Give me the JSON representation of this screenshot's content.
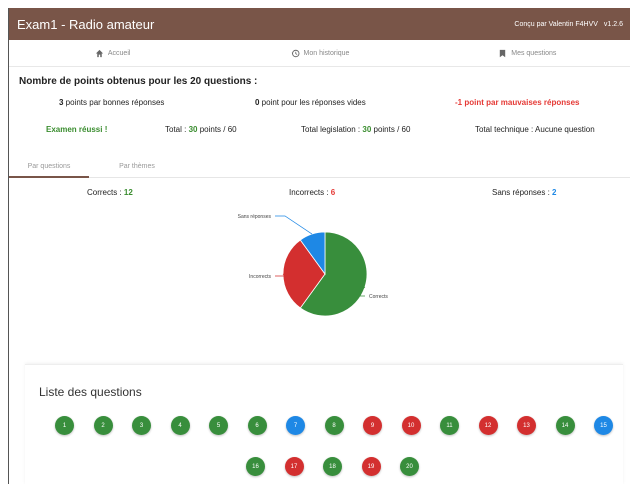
{
  "appbar": {
    "title": "Exam1 - Radio amateur",
    "credit": "Conçu par Valentin F4HVV",
    "version": "v1.2.6"
  },
  "nav": [
    {
      "label": "Accueil",
      "icon": "home-icon"
    },
    {
      "label": "Mon historique",
      "icon": "history-icon"
    },
    {
      "label": "Mes questions",
      "icon": "bookmark-icon"
    }
  ],
  "summary": {
    "title": "Nombre de points obtenus pour les 20 questions :",
    "good_num": "3",
    "good_text": " points par bonnes réponses",
    "empty_num": "0",
    "empty_text": " point pour les réponses vides",
    "bad_text": "-1 point par mauvaises réponses",
    "result": "Examen réussi !",
    "total_label": "Total : ",
    "total_value": "30",
    "total_suffix": " points / 60",
    "legis_label": "Total legislation : ",
    "legis_value": "30",
    "legis_suffix": " points / 60",
    "tech_text": "Total technique : Aucune question"
  },
  "tabs": [
    {
      "label": "Par questions",
      "active": true
    },
    {
      "label": "Par thèmes",
      "active": false
    }
  ],
  "counts": {
    "correct_label": "Corrects : ",
    "correct_value": "12",
    "incorrect_label": "Incorrects : ",
    "incorrect_value": "6",
    "empty_label": "Sans réponses : ",
    "empty_value": "2"
  },
  "chart_data": {
    "type": "pie",
    "slices": [
      {
        "label": "Corrects",
        "value": 12,
        "color": "#388e3c"
      },
      {
        "label": "Incorrects",
        "value": 6,
        "color": "#d32f2f"
      },
      {
        "label": "Sans réponses",
        "value": 2,
        "color": "#1e88e5"
      }
    ]
  },
  "questions": {
    "title": "Liste des questions",
    "colors": {
      "correct": "#388e3c",
      "incorrect": "#d32f2f",
      "empty": "#1e88e5"
    },
    "items": [
      {
        "n": "1",
        "status": "correct"
      },
      {
        "n": "2",
        "status": "correct"
      },
      {
        "n": "3",
        "status": "correct"
      },
      {
        "n": "4",
        "status": "correct"
      },
      {
        "n": "5",
        "status": "correct"
      },
      {
        "n": "6",
        "status": "correct"
      },
      {
        "n": "7",
        "status": "empty"
      },
      {
        "n": "8",
        "status": "correct"
      },
      {
        "n": "9",
        "status": "incorrect"
      },
      {
        "n": "10",
        "status": "incorrect"
      },
      {
        "n": "11",
        "status": "correct"
      },
      {
        "n": "12",
        "status": "incorrect"
      },
      {
        "n": "13",
        "status": "incorrect"
      },
      {
        "n": "14",
        "status": "correct"
      },
      {
        "n": "15",
        "status": "empty"
      },
      {
        "n": "16",
        "status": "correct"
      },
      {
        "n": "17",
        "status": "incorrect"
      },
      {
        "n": "18",
        "status": "correct"
      },
      {
        "n": "19",
        "status": "incorrect"
      },
      {
        "n": "20",
        "status": "correct"
      }
    ]
  }
}
